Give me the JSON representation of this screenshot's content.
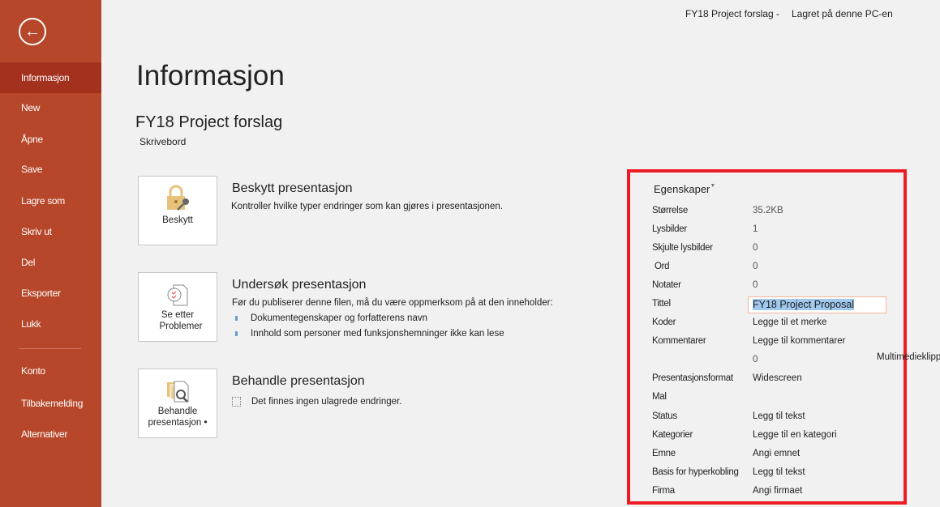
{
  "topbar": {
    "file": "FY18 Project forslag -",
    "saved": "Lagret på denne PC-en"
  },
  "sidebar": {
    "items": [
      {
        "label": "Informasjon"
      },
      {
        "label": "New"
      },
      {
        "label": "Åpne"
      },
      {
        "label": "Save"
      },
      {
        "label": "Lagre som"
      },
      {
        "label": "Skriv ut"
      },
      {
        "label": "Del"
      },
      {
        "label": "Eksporter"
      },
      {
        "label": "Lukk"
      },
      {
        "label": "Konto"
      },
      {
        "label": "Tilbakemelding"
      },
      {
        "label": "Alternativer"
      }
    ]
  },
  "main": {
    "title": "Informasjon",
    "file_name": "FY18 Project forslag",
    "location": "Skrivebord",
    "sections": [
      {
        "button": "Beskytt",
        "heading": "Beskytt presentasjon",
        "desc": "Kontroller hvilke typer endringer som kan gjøres i presentasjonen."
      },
      {
        "button_line1": "Se etter",
        "button_line2": "Problemer",
        "heading": "Undersøk presentasjon",
        "desc": "Før du publiserer denne filen, må du være oppmerksom på at den inneholder:",
        "bullets": [
          "Dokumentegenskaper og forfatterens navn",
          "Innhold som personer med funksjonshemninger ikke kan lese"
        ]
      },
      {
        "button_line1": "Behandle",
        "button_line2": "presentasjon •",
        "heading": "Behandle presentasjon",
        "desc": "Det finnes ingen ulagrede endringer."
      }
    ]
  },
  "properties": {
    "header": "Egenskaper",
    "rows": [
      {
        "label": "Størrelse",
        "value": "35.2KB"
      },
      {
        "label": "Lysbilder",
        "value": "1"
      },
      {
        "label": "Skjulte lysbilder",
        "value": "0"
      },
      {
        "label": "Ord",
        "value": "0"
      },
      {
        "label": "Notater",
        "value": "0"
      },
      {
        "label": "Tittel",
        "value": "FY18 Project Proposal"
      },
      {
        "label": "Koder",
        "value": "Legge til et merke"
      },
      {
        "label": "Kommentarer",
        "value": "Legge til kommentarer"
      },
      {
        "label": "",
        "value": "0",
        "extra": "Multimedieklipp"
      },
      {
        "label": "Presentasjonsformat",
        "value": "Widescreen"
      },
      {
        "label": "Mal",
        "value": ""
      },
      {
        "label": "Status",
        "value": "Legg til tekst"
      },
      {
        "label": "Kategorier",
        "value": "Legge til en kategori"
      },
      {
        "label": "Emne",
        "value": "Angi emnet"
      },
      {
        "label": "Basis for hyperkobling",
        "value": "Legg til tekst"
      },
      {
        "label": "Firma",
        "value": "Angi firmaet"
      }
    ]
  },
  "colors": {
    "sidebar": "#b7472a",
    "selected": "#a4301e",
    "highlight_box": "#ed1c24"
  }
}
